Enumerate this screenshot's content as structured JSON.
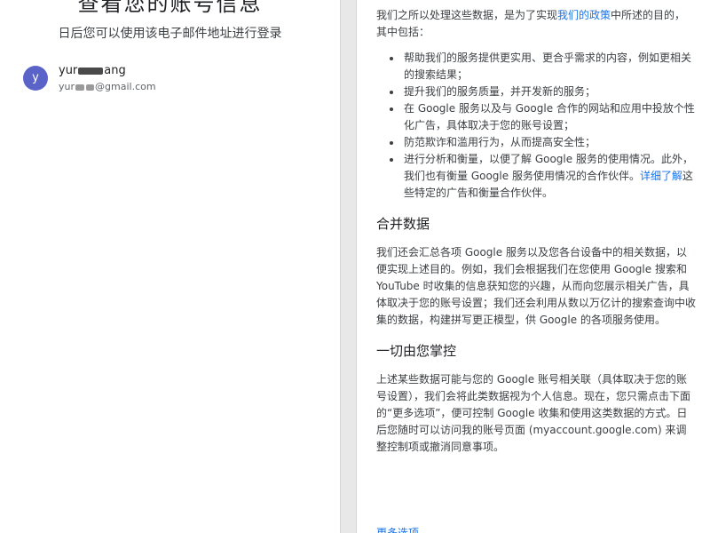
{
  "left": {
    "title": "查看您的账号信息",
    "subtitle": "日后您可以使用该电子邮件地址进行登录",
    "account": {
      "avatar_letter": "y",
      "name_start": "yur",
      "name_end": "ang",
      "email_start": "yur",
      "email_end": "@gmail.com"
    }
  },
  "right": {
    "intro": {
      "before": "我们之所以处理这些数据，是为了实现",
      "link": "我们的政策",
      "after": "中所述的目的，其中包括："
    },
    "bullets": [
      "帮助我们的服务提供更实用、更合乎需求的内容，例如更相关的搜索结果；",
      "提升我们的服务质量，并开发新的服务；",
      "在 Google 服务以及与 Google 合作的网站和应用中投放个性化广告，具体取决于您的账号设置；",
      "防范欺诈和滥用行为，从而提高安全性；"
    ],
    "last_bullet": {
      "before": "进行分析和衡量，以便了解 Google 服务的使用情况。此外，我们也有衡量 Google 服务使用情况的合作伙伴。",
      "link": "详细了解",
      "after": "这些特定的广告和衡量合作伙伴。"
    },
    "section1": {
      "heading": "合并数据",
      "body": "我们还会汇总各项 Google 服务以及您各台设备中的相关数据，以便实现上述目的。例如，我们会根据我们在您使用 Google 搜索和 YouTube 时收集的信息获知您的兴趣，从而向您展示相关广告，具体取决于您的账号设置；我们还会利用从数以万亿计的搜索查询中收集的数据，构建拼写更正模型，供 Google 的各项服务使用。"
    },
    "section2": {
      "heading": "一切由您掌控",
      "body": "上述某些数据可能与您的 Google 账号相关联（具体取决于您的账号设置），我们会将此类数据视为个人信息。现在，您只需点击下面的“更多选项”，便可控制 Google 收集和使用这类数据的方式。日后您随时可以访问我的账号页面 (myaccount.google.com) 来调整控制项或撤消同意事项。"
    },
    "more_options": "更多选项"
  },
  "colors": {
    "accent": "#1a73e8",
    "avatar": "#5a64c8"
  }
}
